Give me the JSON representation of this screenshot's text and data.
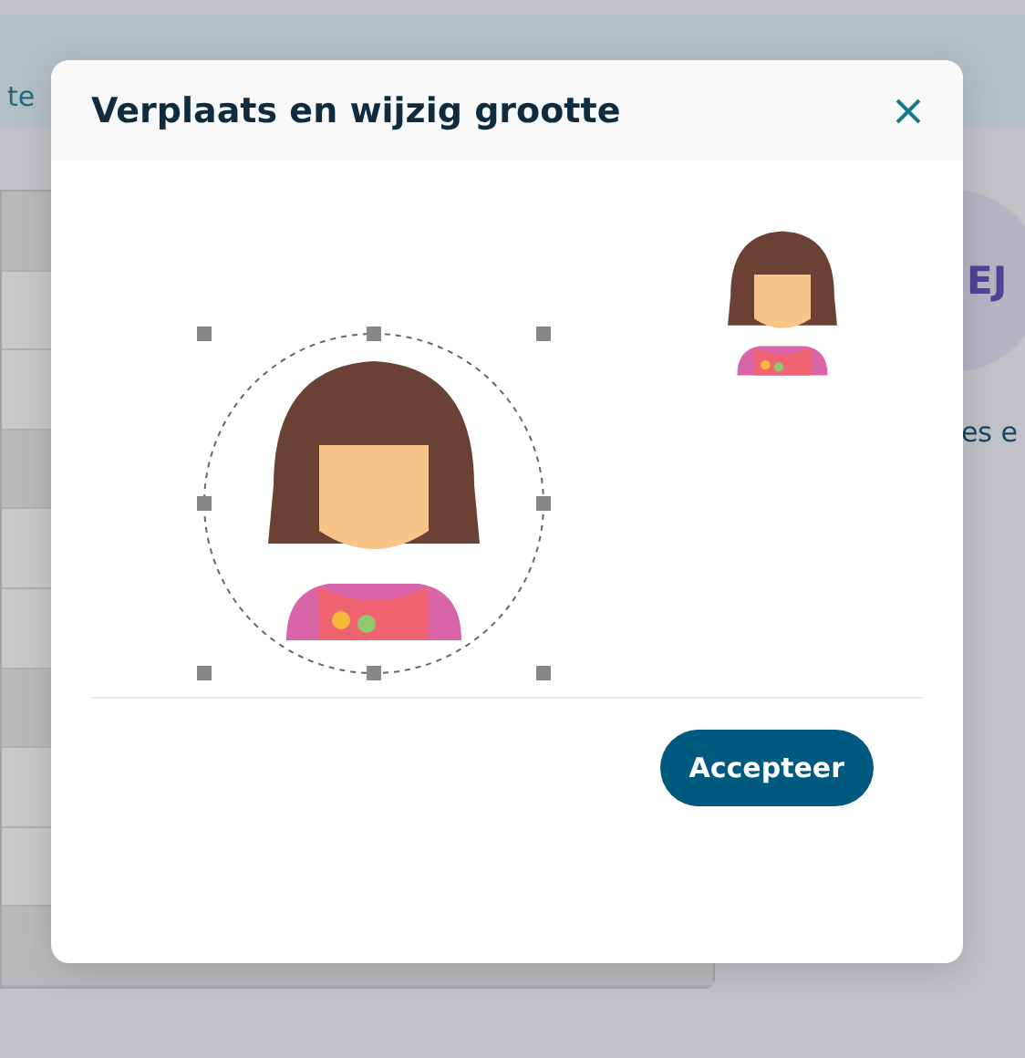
{
  "background": {
    "banner_text": "te",
    "avatar_initials": "EJ",
    "caption": "es e"
  },
  "dialog": {
    "title": "Verplaats en wijzig grootte",
    "accept_button": "Accepteer"
  }
}
